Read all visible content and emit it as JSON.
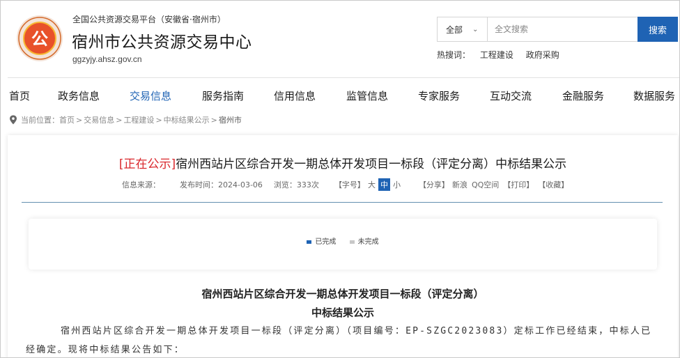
{
  "header": {
    "platform_name": "全国公共资源交易平台（安徽省·宿州市）",
    "site_title": "宿州市公共资源交易中心",
    "domain": "ggzyjy.ahsz.gov.cn",
    "logo_text": "公"
  },
  "search": {
    "scope": "全部",
    "placeholder": "全文搜索",
    "button": "搜索",
    "hot_label": "热搜词：",
    "hot_words": [
      "工程建设",
      "政府采购"
    ]
  },
  "nav": {
    "items": [
      "首页",
      "政务信息",
      "交易信息",
      "服务指南",
      "信用信息",
      "监管信息",
      "专家服务",
      "互动交流",
      "金融服务",
      "数据服务"
    ],
    "active_index": 2
  },
  "breadcrumb": {
    "label": "当前位置：",
    "items": [
      "首页",
      "交易信息",
      "工程建设",
      "中标结果公示",
      "宿州市"
    ]
  },
  "article": {
    "tag": "[正在公示]",
    "title": "宿州西站片区综合开发一期总体开发项目一标段（评定分离）中标结果公示",
    "meta": {
      "source": "信息来源：",
      "date": "发布时间：2024-03-06",
      "views": "浏览：333次",
      "font_label": "【字号】",
      "font_sizes": [
        "大",
        "中",
        "小"
      ],
      "share_label": "【分享】",
      "share_targets": [
        "新浪",
        "QQ空间"
      ],
      "print": "【打印】",
      "collect": "【收藏】"
    },
    "legend": {
      "done": "已完成",
      "pending": "未完成"
    },
    "body_title_1": "宿州西站片区综合开发一期总体开发项目一标段（评定分离）",
    "body_title_2": "中标结果公示",
    "body_para": "宿州西站片区综合开发一期总体开发项目一标段（评定分离）（项目编号：EP-SZGC2023083）定标工作已经结束，中标人已经确定。现将中标结果公告如下："
  },
  "colors": {
    "accent": "#1f63b4",
    "tag_red": "#d9262b",
    "done": "#1f63b4",
    "pending": "#c8c8c8"
  }
}
